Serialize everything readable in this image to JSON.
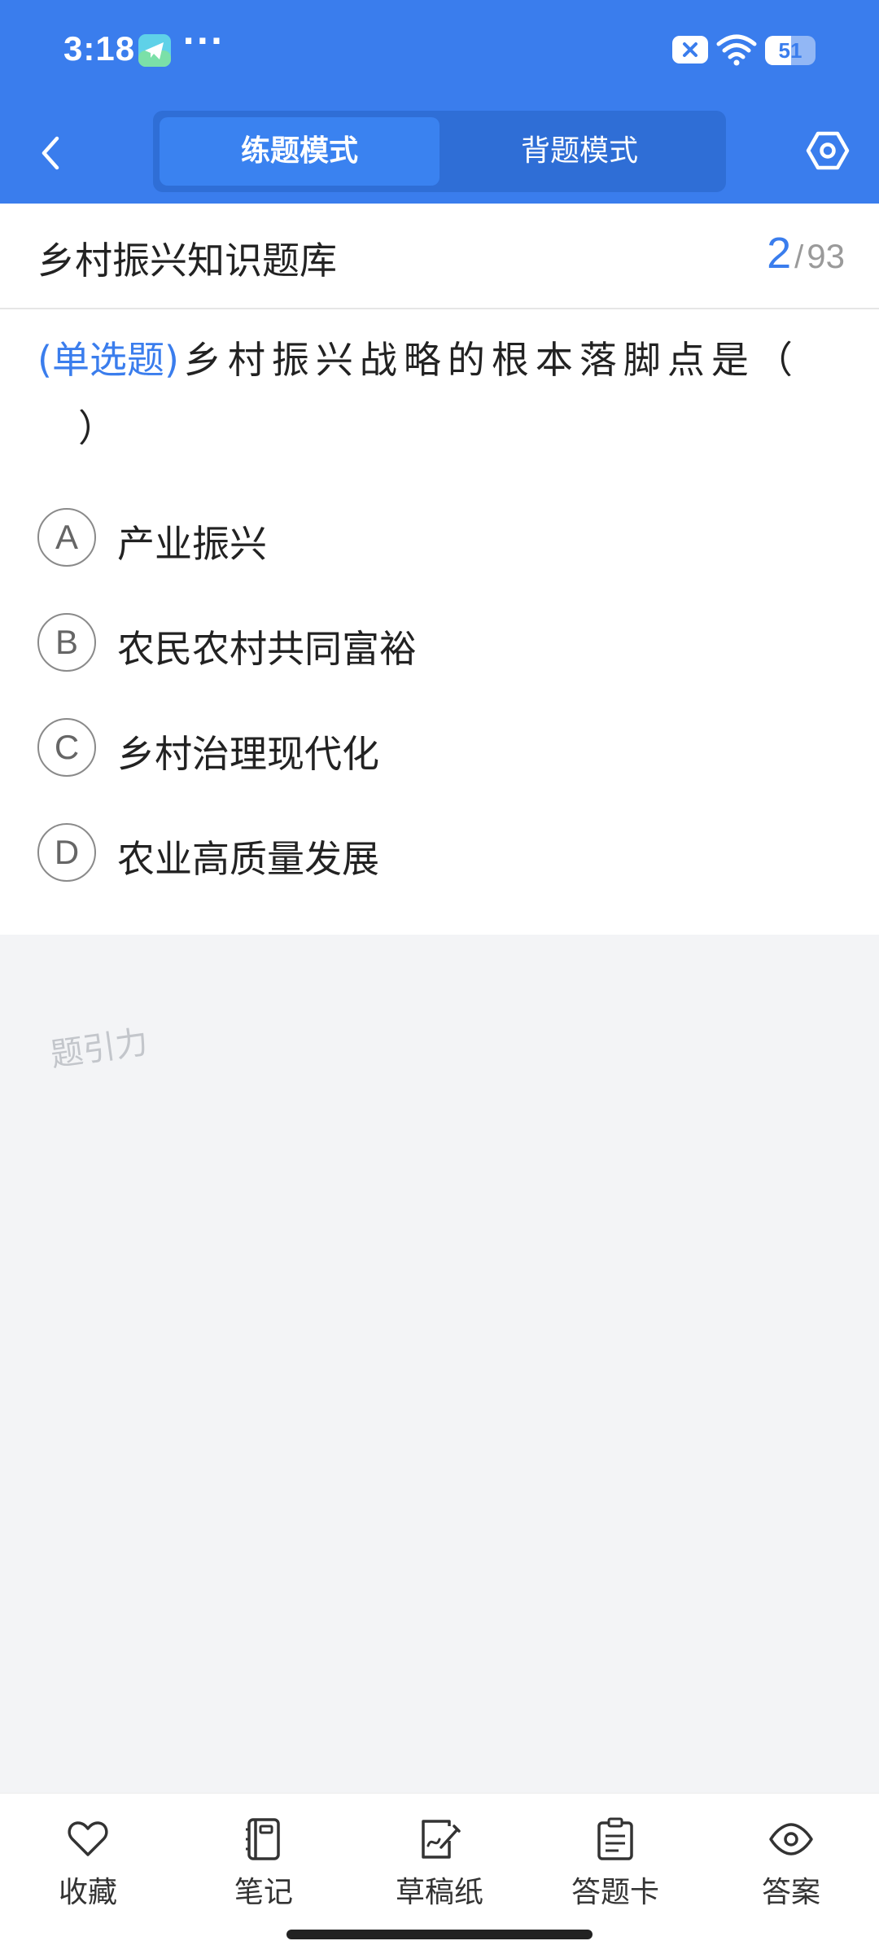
{
  "status_bar": {
    "time": "3:18",
    "dots": "···",
    "battery_level": "51",
    "icons": [
      "telegram-icon",
      "sim-off-icon",
      "wifi-icon",
      "battery-icon"
    ]
  },
  "nav": {
    "modes": [
      {
        "label": "练题模式",
        "active": true
      },
      {
        "label": "背题模式",
        "active": false
      }
    ],
    "icons": [
      "back-icon",
      "settings-icon"
    ]
  },
  "bank": {
    "title": "乡村振兴知识题库",
    "current": "2",
    "separator": "/",
    "total": "93"
  },
  "question": {
    "type": "(单选题)",
    "text": "乡村振兴战略的根本落脚点是（",
    "closing": "）",
    "options": [
      {
        "letter": "A",
        "text": "产业振兴"
      },
      {
        "letter": "B",
        "text": "农民农村共同富裕"
      },
      {
        "letter": "C",
        "text": "乡村治理现代化"
      },
      {
        "letter": "D",
        "text": "农业高质量发展"
      }
    ]
  },
  "watermark": "题引力",
  "toolbar": {
    "items": [
      {
        "label": "收藏",
        "icon": "heart-icon"
      },
      {
        "label": "笔记",
        "icon": "notebook-icon"
      },
      {
        "label": "草稿纸",
        "icon": "draft-paper-icon"
      },
      {
        "label": "答题卡",
        "icon": "answer-card-icon"
      },
      {
        "label": "答案",
        "icon": "eye-icon"
      }
    ]
  },
  "colors": {
    "primary": "#3a7ded",
    "background": "#f3f4f6",
    "text": "#222222"
  }
}
